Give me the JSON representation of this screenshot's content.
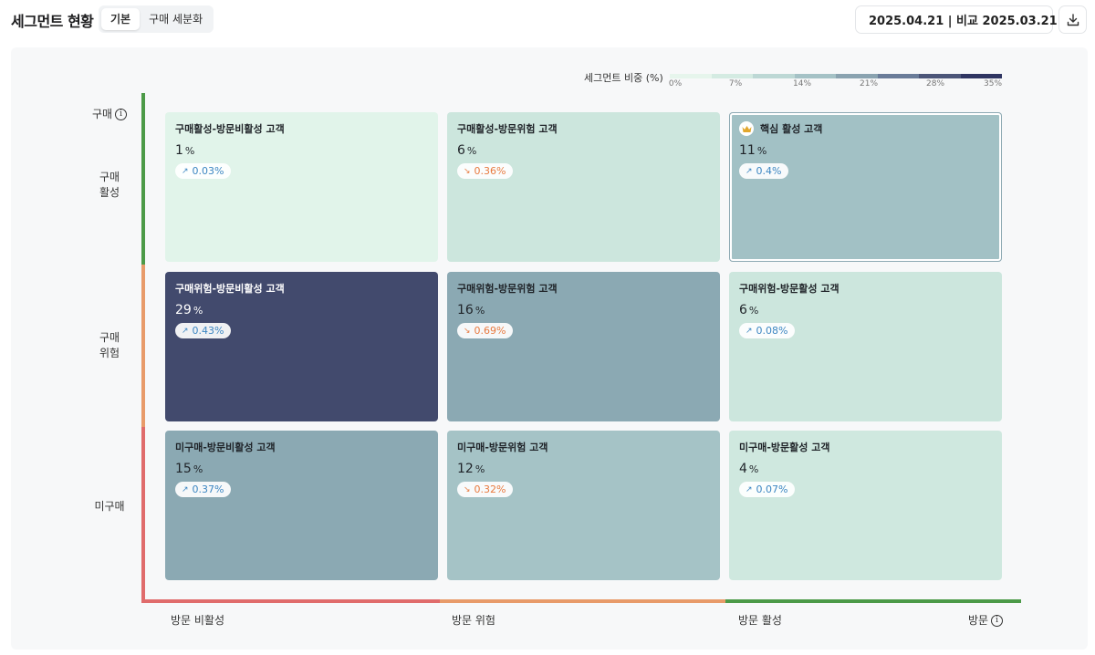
{
  "header": {
    "title": "세그먼트 현황",
    "tabs": [
      {
        "label": "기본",
        "active": true
      },
      {
        "label": "구매 세분화",
        "active": false
      }
    ],
    "date_range": "2025.04.21 | 비교 2025.03.21"
  },
  "legend": {
    "label": "세그먼트 비중 (%)",
    "ticks": [
      "0%",
      "7%",
      "14%",
      "21%",
      "28%",
      "35%"
    ],
    "colors": [
      "#e6f5ec",
      "#d4ebe2",
      "#bdd8d5",
      "#a5c2c6",
      "#8aa3b0",
      "#6a7c99",
      "#4c5679",
      "#2f3562"
    ]
  },
  "axes": {
    "y_title": "구매",
    "y_rows": [
      "구매\n활성",
      "구매\n위험",
      "미구매"
    ],
    "x_title": "방문",
    "x_cols": [
      "방문 비활성",
      "방문 위험",
      "방문 활성"
    ],
    "colors": {
      "active": "#4c9a48",
      "risk": "#e89b6a",
      "inactive": "#e06c6c"
    }
  },
  "cells": [
    {
      "name": "구매활성-방문비활성 고객",
      "value": "1",
      "unit": "%",
      "change": "0.03%",
      "trend": "up",
      "bg": "#e1f4ea",
      "dark": false,
      "crown": false
    },
    {
      "name": "구매활성-방문위험 고객",
      "value": "6",
      "unit": "%",
      "change": "0.36%",
      "trend": "down",
      "bg": "#cce6dd",
      "dark": false,
      "crown": false
    },
    {
      "name": "핵심 활성 고객",
      "value": "11",
      "unit": "%",
      "change": "0.4%",
      "trend": "up",
      "bg": "#a2c1c5",
      "dark": false,
      "crown": true
    },
    {
      "name": "구매위험-방문비활성 고객",
      "value": "29",
      "unit": "%",
      "change": "0.43%",
      "trend": "up",
      "bg": "#424a6d",
      "dark": true,
      "crown": false
    },
    {
      "name": "구매위험-방문위험 고객",
      "value": "16",
      "unit": "%",
      "change": "0.69%",
      "trend": "down",
      "bg": "#8ba9b3",
      "dark": false,
      "crown": false
    },
    {
      "name": "구매위험-방문활성 고객",
      "value": "6",
      "unit": "%",
      "change": "0.08%",
      "trend": "up",
      "bg": "#cce6dd",
      "dark": false,
      "crown": false
    },
    {
      "name": "미구매-방문비활성 고객",
      "value": "15",
      "unit": "%",
      "change": "0.37%",
      "trend": "up",
      "bg": "#8ba9b3",
      "dark": false,
      "crown": false
    },
    {
      "name": "미구매-방문위험 고객",
      "value": "12",
      "unit": "%",
      "change": "0.32%",
      "trend": "down",
      "bg": "#a5c3c6",
      "dark": false,
      "crown": false
    },
    {
      "name": "미구매-방문활성 고객",
      "value": "4",
      "unit": "%",
      "change": "0.07%",
      "trend": "up",
      "bg": "#cfe8df",
      "dark": false,
      "crown": false
    }
  ]
}
